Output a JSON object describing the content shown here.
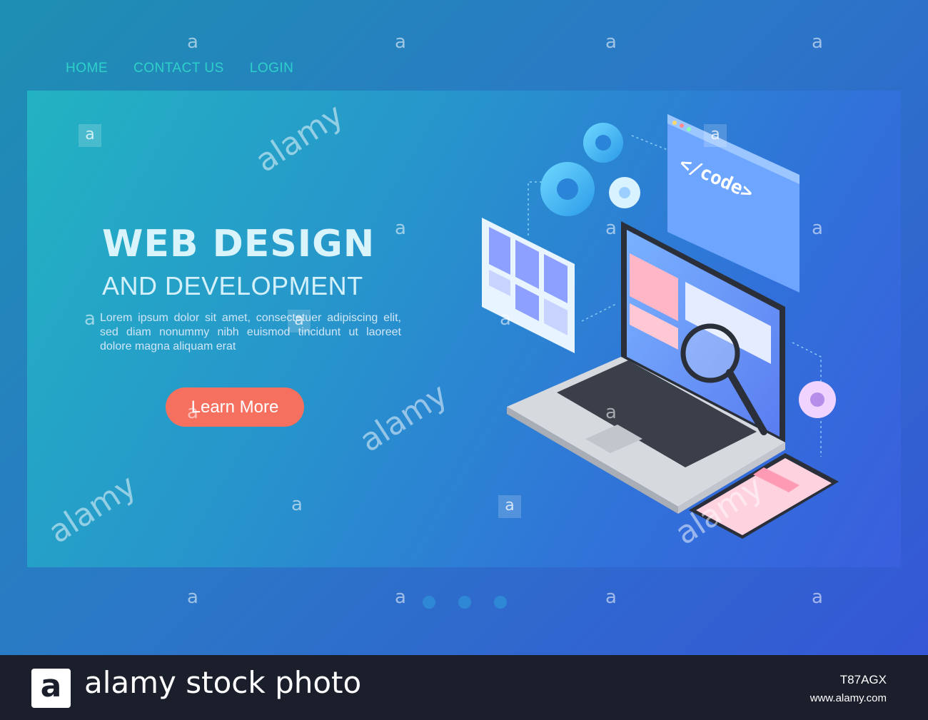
{
  "nav": {
    "items": [
      {
        "label": "HOME"
      },
      {
        "label": "CONTACT US"
      },
      {
        "label": "LOGIN"
      }
    ]
  },
  "hero": {
    "title": "WEB DESIGN",
    "subtitle": "AND DEVELOPMENT",
    "body": "Lorem ipsum dolor sit amet, consectetuer adipiscing elit, sed diam nonummy nibh euismod tincidunt ut laoreet dolore magna aliquam erat",
    "cta_label": "Learn More"
  },
  "illustration": {
    "code_window_text": "</code>",
    "icons": [
      "gear-icon",
      "code-window-icon",
      "layout-grid-icon",
      "laptop-icon",
      "magnifier-icon",
      "tablet-icon"
    ]
  },
  "carousel": {
    "dot_count": 3
  },
  "watermark": {
    "letter": "a",
    "logo_text": "alamy"
  },
  "footer": {
    "logo_letter": "a",
    "brand_text": "alamy stock photo",
    "image_id": "T87AGX",
    "url": "www.alamy.com"
  },
  "colors": {
    "accent_teal": "#2ed1c9",
    "button": "#f67060",
    "footer_bg": "#1b1e2b"
  }
}
